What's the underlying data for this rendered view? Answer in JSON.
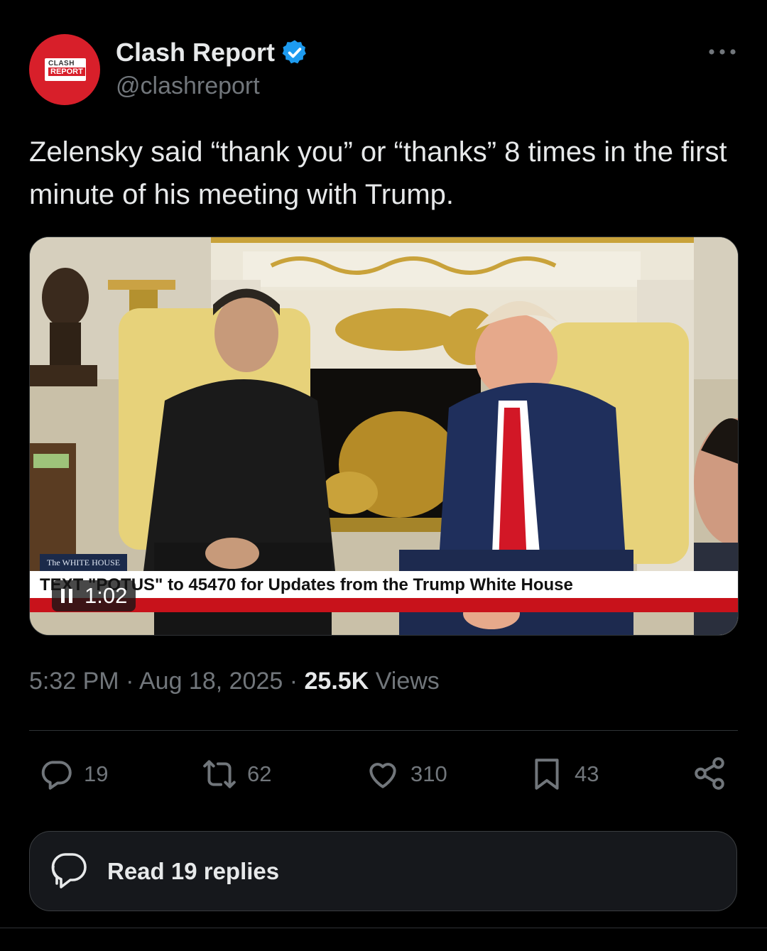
{
  "author": {
    "name": "Clash Report",
    "handle": "@clashreport",
    "avatar_text_line1": "CLASH",
    "avatar_text_line2": "REPORT",
    "brand_color": "#d81f2a",
    "verified_color": "#1d9bf0"
  },
  "tweet": {
    "text": "Zelensky said “thank you” or “thanks” 8 times in the first minute of his meeting with Trump."
  },
  "media": {
    "type": "video",
    "chyron_text": "TEXT \"POTUS\" to 45470 for Updates from the Trump White House",
    "source_label": "The WHITE HOUSE",
    "time_display": "1:02",
    "playback_icon": "pause-icon"
  },
  "meta": {
    "time": "5:32 PM",
    "separator": "·",
    "date": "Aug 18, 2025",
    "views_count": "25.5K",
    "views_label": "Views"
  },
  "actions": {
    "replies": "19",
    "reposts": "62",
    "likes": "310",
    "bookmarks": "43"
  },
  "read_replies_label": "Read 19 replies",
  "colors": {
    "background": "#000000",
    "text_primary": "#e7e9ea",
    "text_secondary": "#71767b",
    "divider": "#2f3336",
    "chyron_red": "#c8121b"
  }
}
